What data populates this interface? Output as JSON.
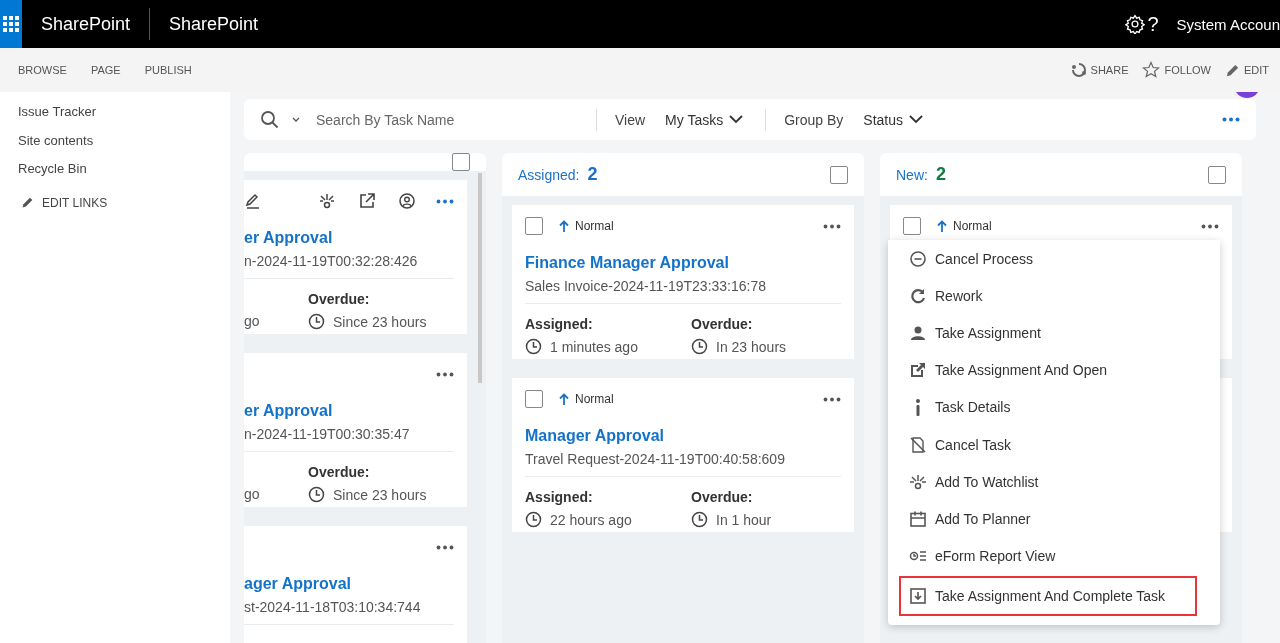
{
  "topbar": {
    "app_title": "SharePoint",
    "site_title": "SharePoint",
    "help_glyph": "?",
    "user": "System Accoun"
  },
  "ribbon": {
    "tabs": [
      "BROWSE",
      "PAGE",
      "PUBLISH"
    ],
    "actions": [
      {
        "kind": "share",
        "label": "SHARE"
      },
      {
        "kind": "follow",
        "label": "FOLLOW"
      },
      {
        "kind": "edit",
        "label": "EDIT"
      }
    ]
  },
  "sidebar": {
    "items": [
      "Issue Tracker",
      "Site contents",
      "Recycle Bin"
    ],
    "edit_links": "EDIT LINKS"
  },
  "toolbar": {
    "search": {
      "placeholder": "Search By Task Name"
    },
    "view_label": "View",
    "view_value": "My Tasks",
    "group_label": "Group By",
    "group_value": "Status"
  },
  "columns": [
    {
      "kind": "cut",
      "checked": false,
      "cards": [
        {
          "kind": "cut",
          "show_actions": true,
          "title": "er Approval",
          "subtitle": "n-2024-11-19T00:32:28:426",
          "assigned_value": "go",
          "overdue_label": "Overdue:",
          "overdue_value": "Since 23 hours"
        },
        {
          "kind": "cut",
          "show_actions": false,
          "title": "er Approval",
          "subtitle": "n-2024-11-19T00:30:35:47",
          "assigned_value": "go",
          "overdue_label": "Overdue:",
          "overdue_value": "Since 23 hours"
        },
        {
          "kind": "cut",
          "show_actions": false,
          "title": "ager Approval",
          "subtitle": "st-2024-11-18T03:10:34:744"
        }
      ]
    },
    {
      "kind": "full",
      "title": "Assigned:",
      "count": "2",
      "color": "#1a6fc9",
      "checked": false,
      "cards": [
        {
          "kind": "full",
          "checked": false,
          "priority": "Normal",
          "title": "Finance Manager Approval",
          "subtitle": "Sales Invoice-2024-11-19T23:33:16:78",
          "assigned_label": "Assigned:",
          "assigned_value": "1 minutes ago",
          "overdue_label": "Overdue:",
          "overdue_value": "In 23 hours"
        },
        {
          "kind": "full",
          "checked": false,
          "priority": "Normal",
          "title": "Manager Approval",
          "subtitle": "Travel Request-2024-11-19T00:40:58:609",
          "assigned_label": "Assigned:",
          "assigned_value": "22 hours ago",
          "overdue_label": "Overdue:",
          "overdue_value": "In 1 hour"
        }
      ]
    },
    {
      "kind": "full",
      "title": "New:",
      "count": "2",
      "color": "#107c41",
      "checked": false,
      "cards": [
        {
          "kind": "head",
          "checked": false,
          "priority": "Normal"
        },
        {
          "kind": "blank"
        }
      ]
    }
  ],
  "menu": {
    "items": [
      {
        "kind": "cancel-process",
        "label": "Cancel Process",
        "highlighted": false
      },
      {
        "kind": "rework",
        "label": "Rework",
        "highlighted": false
      },
      {
        "kind": "person",
        "label": "Take Assignment",
        "highlighted": false
      },
      {
        "kind": "open",
        "label": "Take Assignment And Open",
        "highlighted": false
      },
      {
        "kind": "info",
        "label": "Task Details",
        "highlighted": false
      },
      {
        "kind": "cancel-task",
        "label": "Cancel Task",
        "highlighted": false
      },
      {
        "kind": "watch",
        "label": "Add To Watchlist",
        "highlighted": false
      },
      {
        "kind": "planner",
        "label": "Add To Planner",
        "highlighted": false
      },
      {
        "kind": "report",
        "label": "eForm Report View",
        "highlighted": false
      },
      {
        "kind": "complete",
        "label": "Take Assignment And Complete Task",
        "highlighted": true
      }
    ]
  }
}
